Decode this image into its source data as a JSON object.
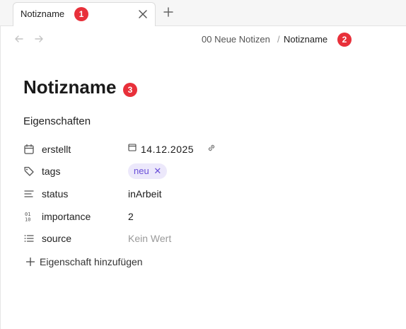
{
  "tab": {
    "title": "Notizname"
  },
  "badges": {
    "b1": "1",
    "b2": "2",
    "b3": "3"
  },
  "breadcrumb": {
    "parent": "00 Neue Notizen",
    "separator": "/",
    "current": "Notizname"
  },
  "note": {
    "title": "Notizname"
  },
  "properties": {
    "heading": "Eigenschaften",
    "items": [
      {
        "name": "erstellt",
        "value": "14.12.2025",
        "icon": "calendar-icon"
      },
      {
        "name": "tags",
        "value": "neu",
        "icon": "tag-icon"
      },
      {
        "name": "status",
        "value": "inArbeit",
        "icon": "text-lines-icon"
      },
      {
        "name": "importance",
        "value": "2",
        "icon": "number-icon"
      },
      {
        "name": "source",
        "value": "Kein Wert",
        "icon": "list-icon"
      }
    ],
    "add_label": "Eigenschaft hinzufügen"
  },
  "colors": {
    "accent": "#6a4fd8",
    "badge": "#e8303a",
    "tag_bg": "#ece8fb"
  }
}
